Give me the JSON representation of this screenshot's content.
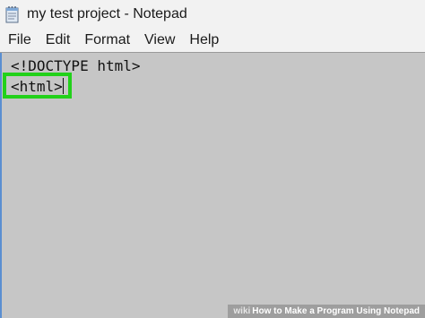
{
  "window": {
    "title": "my test project - Notepad"
  },
  "menu": {
    "items": [
      "File",
      "Edit",
      "Format",
      "View",
      "Help"
    ]
  },
  "editor": {
    "lines": [
      "<!DOCTYPE html>",
      "<html>"
    ],
    "highlight_color": "#22d11a"
  },
  "watermark": {
    "brand": "wiki",
    "text": "How to Make a Program Using Notepad"
  },
  "icons": {
    "app": "notepad-icon"
  }
}
